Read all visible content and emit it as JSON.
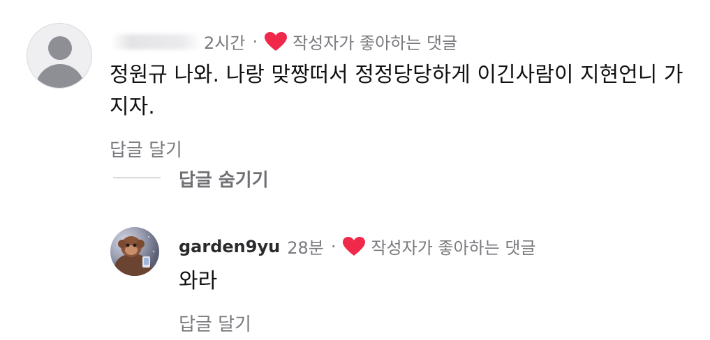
{
  "comments": [
    {
      "time": "2시간",
      "separator": "·",
      "liked_label": "작성자가 좋아하는 댓글",
      "text": "정원규 나와. 나랑 맞짱떠서 정정당당하게 이긴사람이 지현언니 가지자.",
      "reply_label": "답글 달기",
      "hide_replies_label": "답글 숨기기"
    }
  ],
  "reply": {
    "username": "garden9yu",
    "time": "28분",
    "separator": "·",
    "liked_label": "작성자가 좋아하는 댓글",
    "text": "와라",
    "reply_label": "답글 달기"
  },
  "colors": {
    "heart": "#f02849",
    "meta_text": "#7a7a7f"
  }
}
